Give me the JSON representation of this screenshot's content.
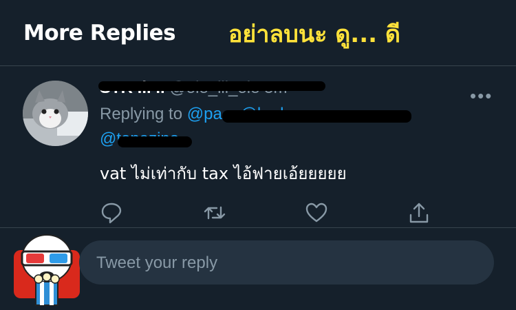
{
  "header": {
    "title": "More Replies",
    "caption": "อย่าลบนะ ดู... ดี"
  },
  "tweet": {
    "author_name": "STR .i. ıı",
    "author_handle": "@ole_lli_ole 5m",
    "replying_prefix": "Replying to",
    "replying_handles": "@pa... @l...d",
    "replying_handle_2": "@topazino",
    "text": "vat ไม่เท่ากับ tax ไอ้ฟายเอ้ยยยยย",
    "more_icon": "more-dots-icon",
    "actions": [
      "reply-icon",
      "retweet-icon",
      "like-icon",
      "share-icon"
    ]
  },
  "compose": {
    "placeholder": "Tweet your reply"
  },
  "colors": {
    "background": "#15202b",
    "accent": "#1da1f2",
    "caption": "#ffe23a",
    "muted": "#8899a6"
  }
}
